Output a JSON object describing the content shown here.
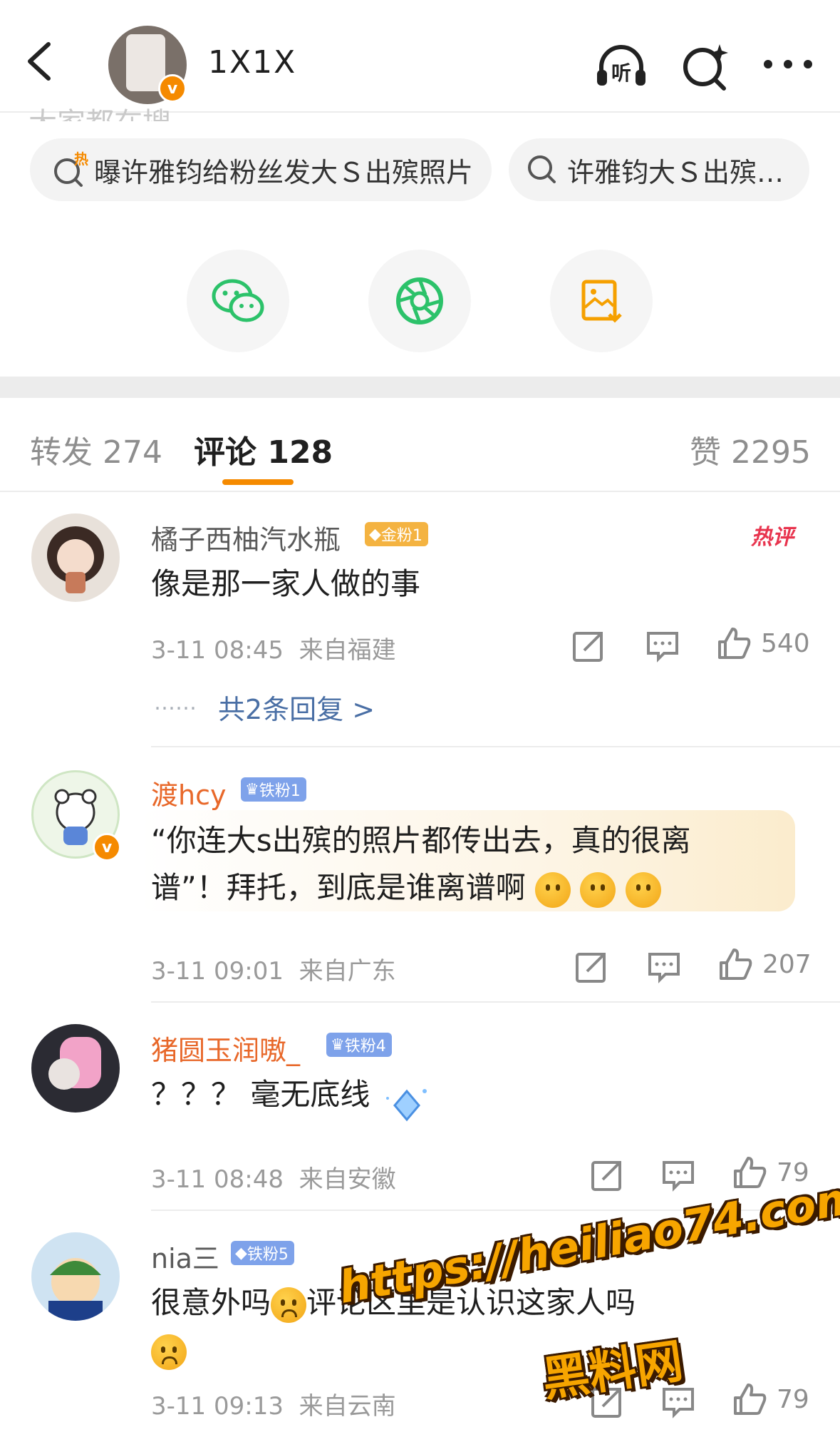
{
  "header": {
    "title": "1X1X",
    "icons": [
      "back-icon",
      "listen-icon",
      "search-sparkle-icon",
      "more-icon"
    ],
    "listen_label": "听",
    "accent": "#f58a00"
  },
  "faded_heading": "大家都在搜",
  "search_chips": [
    {
      "hot_label": "热",
      "text": "曝许雅钧给粉丝发大Ｓ出殡照片"
    },
    {
      "text": "许雅钧大Ｓ出殡…"
    }
  ],
  "share_buttons": [
    "wechat-icon",
    "moments-icon",
    "save-image-icon"
  ],
  "tabs": [
    {
      "label": "转发",
      "count": "274"
    },
    {
      "label": "评论",
      "count": "128"
    },
    {
      "label": "赞",
      "count": "2295"
    }
  ],
  "comments": [
    {
      "name": "橘子西柚汽水瓶",
      "badge": "金粉1",
      "hot_tag": "热评",
      "text": "像是那一家人做的事",
      "time": "3-11 08:45",
      "location": "来自福建",
      "likes": "540",
      "replies": "共2条回复 >",
      "reply_dots": "……"
    },
    {
      "name": "渡hcy",
      "badge": "铁粉1",
      "text_line1": "“你连大s出殡的照片都传出去，真的很离",
      "text_line2": "谱”！拜托，到底是谁离谱啊",
      "time": "3-11 09:01",
      "location": "来自广东",
      "likes": "207"
    },
    {
      "name": "猪圆玉润嗷_",
      "badge": "铁粉4",
      "text": "？？？ 毫无底线",
      "time": "3-11 08:48",
      "location": "来自安徽",
      "likes": "79"
    },
    {
      "name": "nia三",
      "badge": "铁粉5",
      "text_part1": "很意外吗",
      "text_part2": "评论区里是",
      "text_part3": "认识这家人吗",
      "time": "3-11 09:13",
      "location": "来自云南",
      "likes": "79"
    }
  ],
  "watermark": {
    "url": "https://heiliao74.com",
    "name": "黑料网"
  }
}
